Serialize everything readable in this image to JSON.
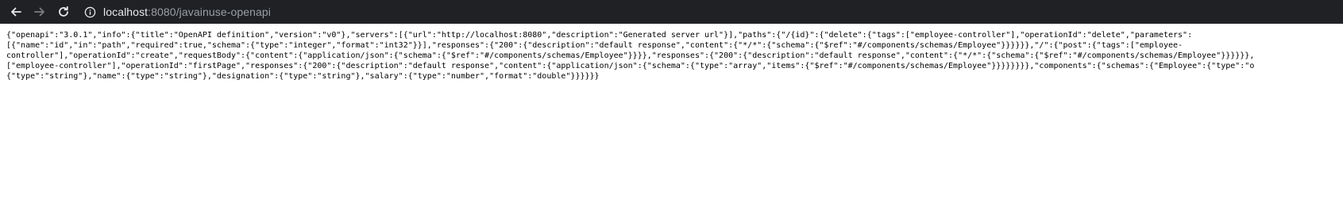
{
  "browser": {
    "url_host": "localhost",
    "url_rest": ":8080/javainuse-openapi"
  },
  "content": {
    "lines": [
      "{\"openapi\":\"3.0.1\",\"info\":{\"title\":\"OpenAPI definition\",\"version\":\"v0\"},\"servers\":[{\"url\":\"http://localhost:8080\",\"description\":\"Generated server url\"}],\"paths\":{\"/{id}\":{\"delete\":{\"tags\":[\"employee-controller\"],\"operationId\":\"delete\",\"parameters\":",
      "[{\"name\":\"id\",\"in\":\"path\",\"required\":true,\"schema\":{\"type\":\"integer\",\"format\":\"int32\"}}],\"responses\":{\"200\":{\"description\":\"default response\",\"content\":{\"*/*\":{\"schema\":{\"$ref\":\"#/components/schemas/Employee\"}}}}}},\"/\":{\"post\":{\"tags\":[\"employee-",
      "controller\"],\"operationId\":\"create\",\"requestBody\":{\"content\":{\"application/json\":{\"schema\":{\"$ref\":\"#/components/schemas/Employee\"}}}},\"responses\":{\"200\":{\"description\":\"default response\",\"content\":{\"*/*\":{\"schema\":{\"$ref\":\"#/components/schemas/Employee\"}}}}}},",
      "[\"employee-controller\"],\"operationId\":\"firstPage\",\"responses\":{\"200\":{\"description\":\"default response\",\"content\":{\"application/json\":{\"schema\":{\"type\":\"array\",\"items\":{\"$ref\":\"#/components/schemas/Employee\"}}}}}}}},\"components\":{\"schemas\":{\"Employee\":{\"type\":\"o",
      "{\"type\":\"string\"},\"name\":{\"type\":\"string\"},\"designation\":{\"type\":\"string\"},\"salary\":{\"type\":\"number\",\"format\":\"double\"}}}}}}"
    ]
  }
}
